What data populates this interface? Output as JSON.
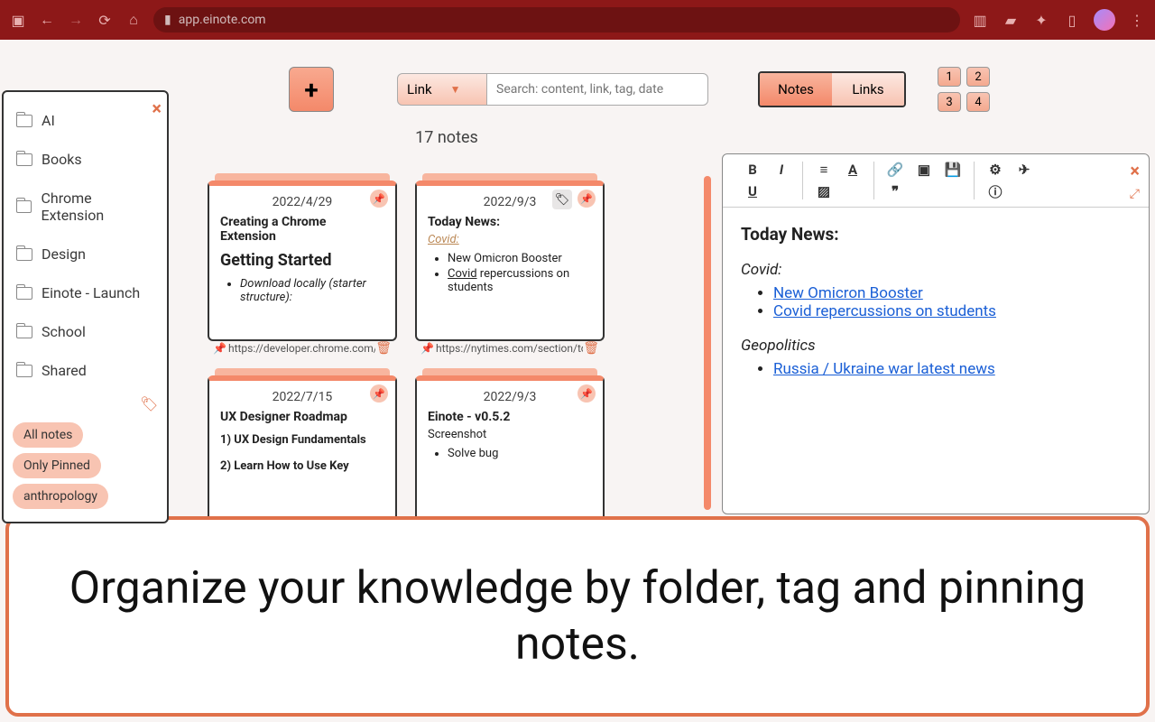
{
  "browser": {
    "url": "app.einote.com"
  },
  "toolbar": {
    "filter_label": "Link",
    "search_placeholder": "Search: content, link, tag, date",
    "tab_notes": "Notes",
    "tab_links": "Links",
    "cols": [
      "1",
      "2",
      "3",
      "4"
    ]
  },
  "sidebar": {
    "folders": [
      "AI",
      "Books",
      "Chrome Extension",
      "Design",
      "Einote - Launch",
      "School",
      "Shared"
    ],
    "tags": [
      "All notes",
      "Only Pinned",
      "anthropology"
    ]
  },
  "notes_count": "17 notes",
  "cards": [
    {
      "date": "2022/4/29",
      "title": "Creating a Chrome Extension",
      "heading": "Getting Started",
      "bullets": [
        "Download locally (starter structure):"
      ],
      "bullets_italic": true,
      "link": "https://developer.chrome.com/d",
      "tag_badge": false
    },
    {
      "date": "2022/9/3",
      "title": "Today News:",
      "sub": "Covid:",
      "bullets": [
        "New Omicron Booster",
        "Covid repercussions on students"
      ],
      "link": "https://nytimes.com/section/to",
      "tag_badge": true
    },
    {
      "date": "2022/7/15",
      "title": "UX Designer Roadmap",
      "lines": [
        "1) UX Design Fundamentals",
        "2) Learn How to Use Key"
      ]
    },
    {
      "date": "2022/9/3",
      "title": "Einote - v0.5.2",
      "subtitle": "Screenshot",
      "bullets": [
        "Solve bug"
      ]
    }
  ],
  "editor": {
    "title": "Today News:",
    "section1": "Covid:",
    "links1": [
      "New Omicron Booster",
      "Covid repercussions on students"
    ],
    "section2": "Geopolitics",
    "links2": [
      "Russia / Ukraine war latest news"
    ]
  },
  "banner": "Organize your knowledge by folder, tag and pinning notes."
}
